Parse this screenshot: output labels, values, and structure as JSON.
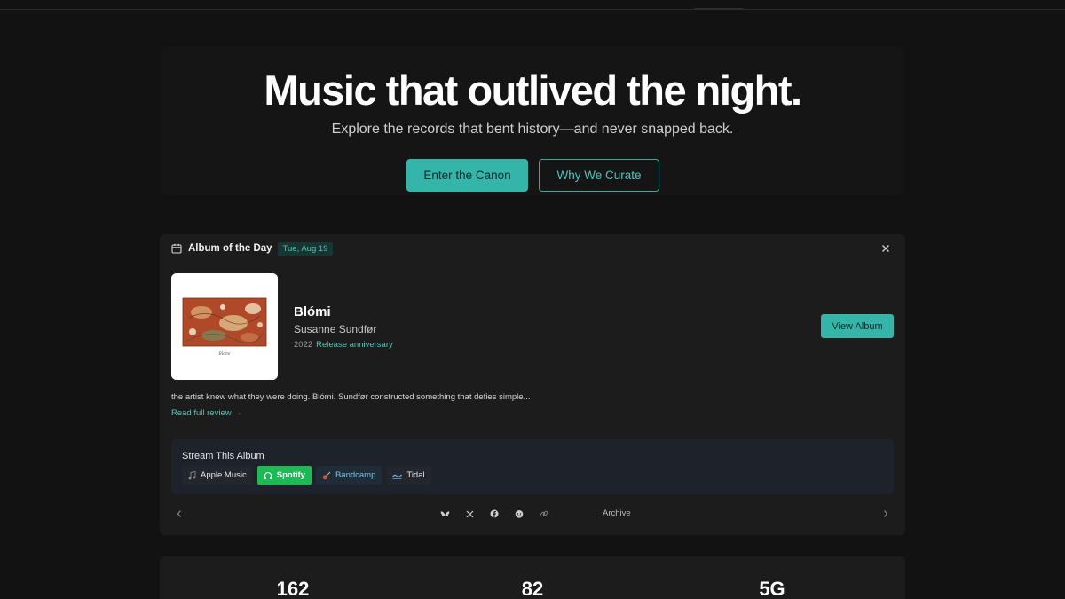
{
  "hero": {
    "title": "Music that outlived the night.",
    "subtitle": "Explore the records that bent history—and never snapped back.",
    "primary_cta": "Enter the Canon",
    "secondary_cta": "Why We Curate"
  },
  "album_card": {
    "heading": "Album of the Day",
    "date": "Tue, Aug 19",
    "icon": "calendar-icon",
    "close_icon": "close-icon",
    "album": {
      "title": "Blómi",
      "artist": "Susanne Sundfør",
      "year": "2022",
      "tag": "Release anniversary",
      "cover_caption": "Blómi"
    },
    "view_button": "View Album",
    "review_excerpt": "the artist knew what they were doing. Blómi, Sundfør constructed something that defies simple...",
    "review_link": "Read full review →",
    "stream": {
      "title": "Stream This Album",
      "services": [
        {
          "label": "Apple Music",
          "icon": "music-note-icon"
        },
        {
          "label": "Spotify",
          "icon": "headphones-icon"
        },
        {
          "label": "Bandcamp",
          "icon": "guitar-icon"
        },
        {
          "label": "Tidal",
          "icon": "wave-icon"
        }
      ]
    },
    "footer": {
      "share_icons": [
        "bluesky-icon",
        "x-icon",
        "facebook-icon",
        "reddit-icon",
        "link-icon"
      ],
      "archive_label": "Archive"
    }
  },
  "stats": [
    "162",
    "82",
    "5G"
  ],
  "colors": {
    "accent": "#35b5aa",
    "accent_text": "#4fc4b9",
    "background": "#121212",
    "card": "#1c1c1c",
    "spotify": "#1db954"
  }
}
